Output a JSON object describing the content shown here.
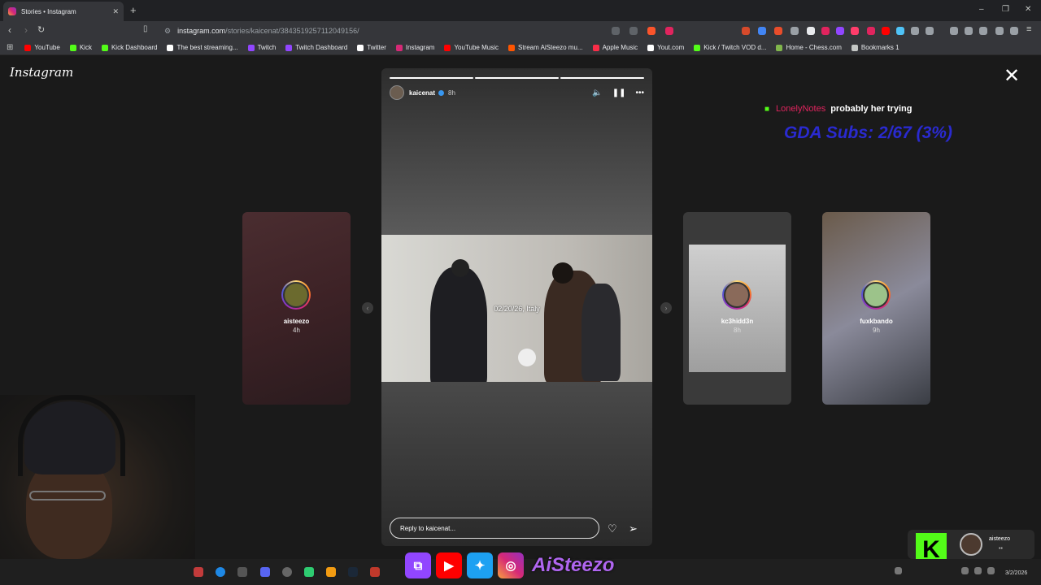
{
  "browser": {
    "tab_title": "Stories • Instagram",
    "new_tab_symbol": "+",
    "url_host": "instagram.com",
    "url_path": "/stories/kaicenat/3843519257112049156/",
    "window_controls": [
      "–",
      "❐",
      "✕"
    ]
  },
  "bookmarks": [
    {
      "label": "YouTube",
      "color": "#ff0000"
    },
    {
      "label": "Kick",
      "color": "#53fc18"
    },
    {
      "label": "Kick Dashboard",
      "color": "#53fc18"
    },
    {
      "label": "The best streaming...",
      "color": "#ffffff"
    },
    {
      "label": "Twitch",
      "color": "#9146ff"
    },
    {
      "label": "Twitch Dashboard",
      "color": "#9146ff"
    },
    {
      "label": "Twitter",
      "color": "#ffffff"
    },
    {
      "label": "Instagram",
      "color": "#d62976"
    },
    {
      "label": "YouTube Music",
      "color": "#ff0000"
    },
    {
      "label": "Stream AiSteezo mu...",
      "color": "#ff5500"
    },
    {
      "label": "Apple Music",
      "color": "#fa2d48"
    },
    {
      "label": "Yout.com",
      "color": "#ffffff"
    },
    {
      "label": "Kick / Twitch VOD d...",
      "color": "#53fc18"
    },
    {
      "label": "Home - Chess.com",
      "color": "#81b64c"
    },
    {
      "label": "Bookmarks 1",
      "color": "#c4c7c5"
    }
  ],
  "instagram": {
    "logo": "Instagram",
    "close_symbol": "✕",
    "main_story": {
      "username": "kaicenat",
      "time_ago": "8h",
      "caption": "02/20/26, Italy",
      "reply_placeholder": "Reply to kaicenat...",
      "segments_total": 3,
      "segments_done": 3
    },
    "side_stories": [
      {
        "username": "aisteezo",
        "time_ago": "4h"
      },
      {
        "username": "kc3hidd3n",
        "time_ago": "8h"
      },
      {
        "username": "fuxkbando",
        "time_ago": "9h"
      }
    ]
  },
  "overlay": {
    "chat_user": "LonelyNotes",
    "chat_message": "probably her trying",
    "subs_goal": "GDA Subs: 2/67 (3%)",
    "kick_username": "aisteezo",
    "kick_sub": "••",
    "social_name": "AiSteezo"
  },
  "taskbar": {
    "date": "3/2/2026"
  },
  "colors": {
    "accent_kick": "#53fc18",
    "subs_text": "#2a2ad0",
    "chat_name": "#e0245e"
  }
}
